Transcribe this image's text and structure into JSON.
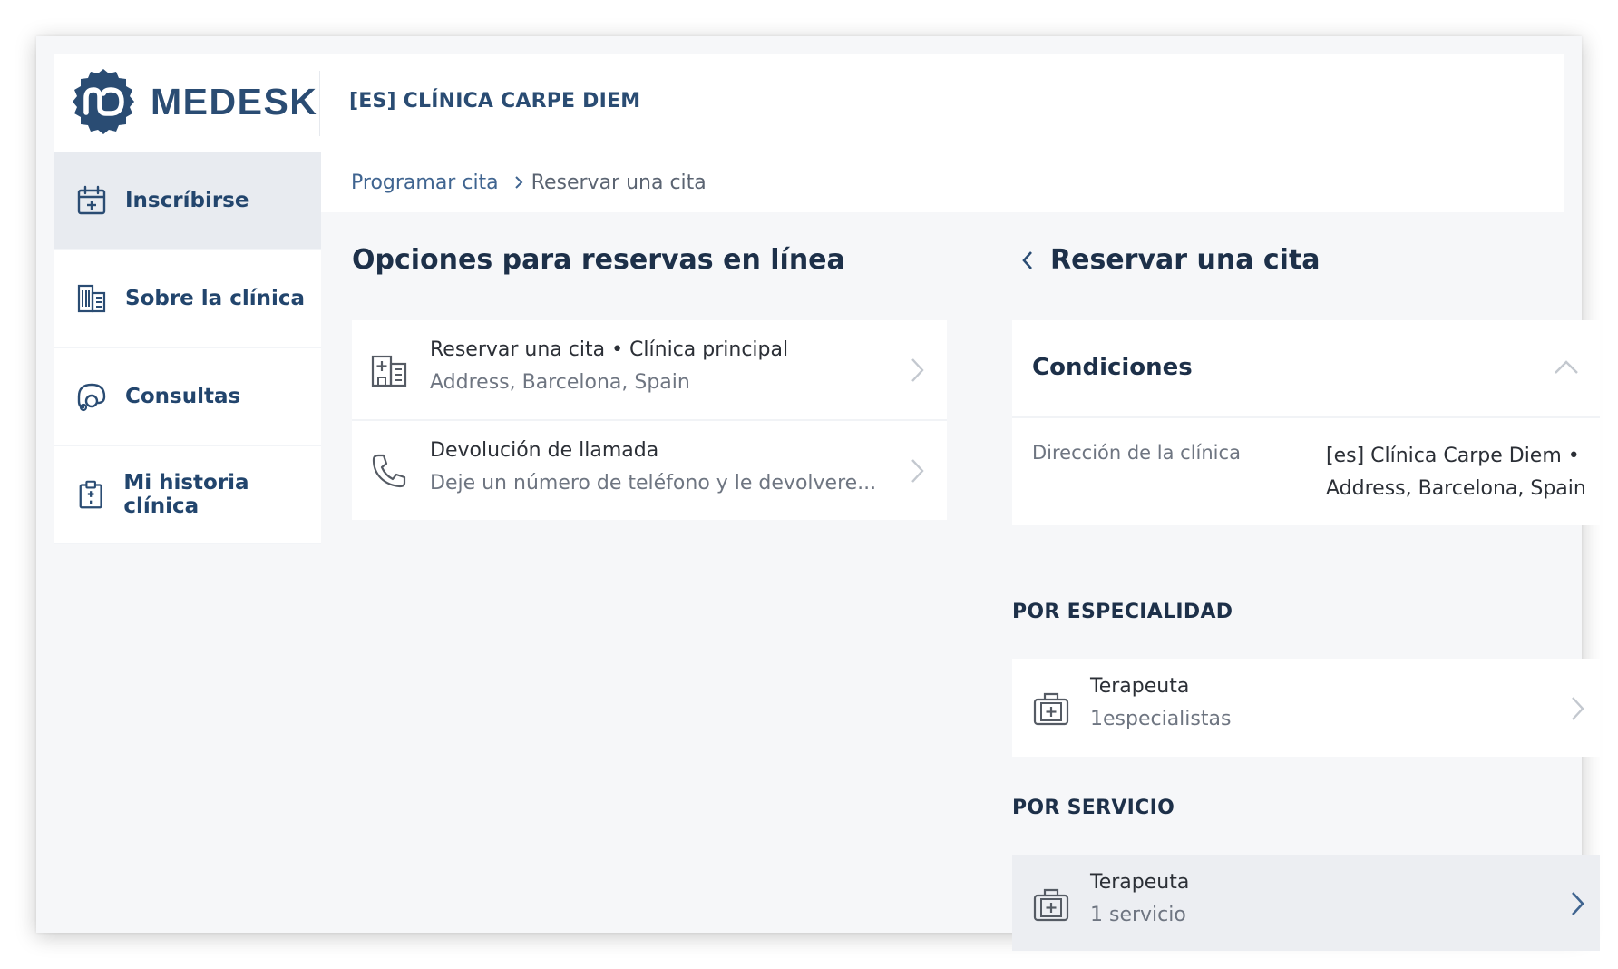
{
  "header": {
    "brand": "MEDESK",
    "clinic_name": "[ES] CLÍNICA CARPE DIEM"
  },
  "sidebar": {
    "items": [
      {
        "label": "Inscríbirse",
        "icon": "calendar-plus-icon",
        "active": true
      },
      {
        "label": "Sobre la clínica",
        "icon": "building-icon",
        "active": false
      },
      {
        "label": "Consultas",
        "icon": "stethoscope-icon",
        "active": false
      },
      {
        "label": "Mi historia clínica",
        "icon": "clipboard-icon",
        "active": false
      }
    ]
  },
  "breadcrumb": {
    "link": "Programar cita",
    "current": "Reservar una cita"
  },
  "left": {
    "title": "Opciones para reservas en línea",
    "options": [
      {
        "title": "Reservar una cita • Clínica principal",
        "subtitle": "Address, Barcelona, Spain",
        "icon": "clinic-building-icon"
      },
      {
        "title": "Devolución de llamada",
        "subtitle": "Deje un número de teléfono y le devolvere...",
        "icon": "phone-icon"
      }
    ]
  },
  "right": {
    "title": "Reservar una cita",
    "conditions": {
      "title": "Condiciones",
      "label": "Dirección de la clínica",
      "value": "[es] Clínica Carpe Diem • Address, Barcelona, Spain"
    },
    "by_specialty": {
      "label": "POR ESPECIALIDAD",
      "item": {
        "title": "Terapeuta",
        "subtitle": "1especialistas"
      }
    },
    "by_service": {
      "label": "POR SERVICIO",
      "item": {
        "title": "Terapeuta",
        "subtitle": "1 servicio"
      }
    }
  },
  "colors": {
    "brand": "#2a4c73",
    "nav_text": "#22456d",
    "active_nav_bg": "#e8ebf0",
    "page_bg": "#f6f7f9"
  }
}
